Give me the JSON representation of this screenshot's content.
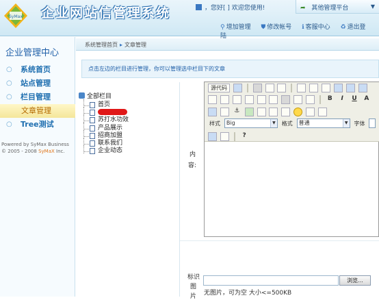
{
  "header": {
    "app_title": "企业网站信管理系统",
    "greeting": "，您好[ ] 欢迎您使用!",
    "platform_label": "其他管理平台",
    "links": [
      {
        "icon": "pin-icon",
        "label": "增加管理"
      },
      {
        "icon": "shield-icon",
        "label": "修改帐号"
      },
      {
        "icon": "info-icon",
        "label": "客服中心"
      },
      {
        "icon": "refresh-icon",
        "label": "退出登陆"
      }
    ]
  },
  "sidebar": {
    "title": "企业管理中心",
    "items": [
      {
        "label": "系统首页",
        "active": false
      },
      {
        "label": "站点管理",
        "active": false
      },
      {
        "label": "栏目管理",
        "active": false
      },
      {
        "label": "文章管理",
        "active": true
      },
      {
        "label": "Tree测试",
        "active": false
      }
    ],
    "powered_line1": "Powered by SyMax Business",
    "powered_line2_pre": "© 2005 - 2008 ",
    "powered_brand": "SyMaX",
    "powered_line2_post": " Inc."
  },
  "breadcrumb": {
    "first": "系统管理首页",
    "second": "文章管理"
  },
  "info_text": "点击左边的栏目进行管理，你可以管理选中栏目下的文章",
  "tree": {
    "root": "全部栏目",
    "items": [
      "首页",
      "",
      "苏打水功效",
      "产品展示",
      "招商加盟",
      "联系我们",
      "企业动态"
    ]
  },
  "form": {
    "content_label_1": "内",
    "content_label_2": "容:",
    "image_label_1": "标识",
    "image_label_2": "图",
    "image_label_3": "片",
    "browse_label": "浏览...",
    "image_hint": "无图片，可为空 大小<=500KB"
  },
  "editor": {
    "source_label": "源代码",
    "style_label": "样式",
    "style_value": "Big",
    "format_label": "格式",
    "format_value": "普通",
    "font_label": "字体"
  },
  "colors": {
    "accent": "#1f5fa8",
    "active_item": "#f4e69a",
    "redaction": "#e01818"
  }
}
